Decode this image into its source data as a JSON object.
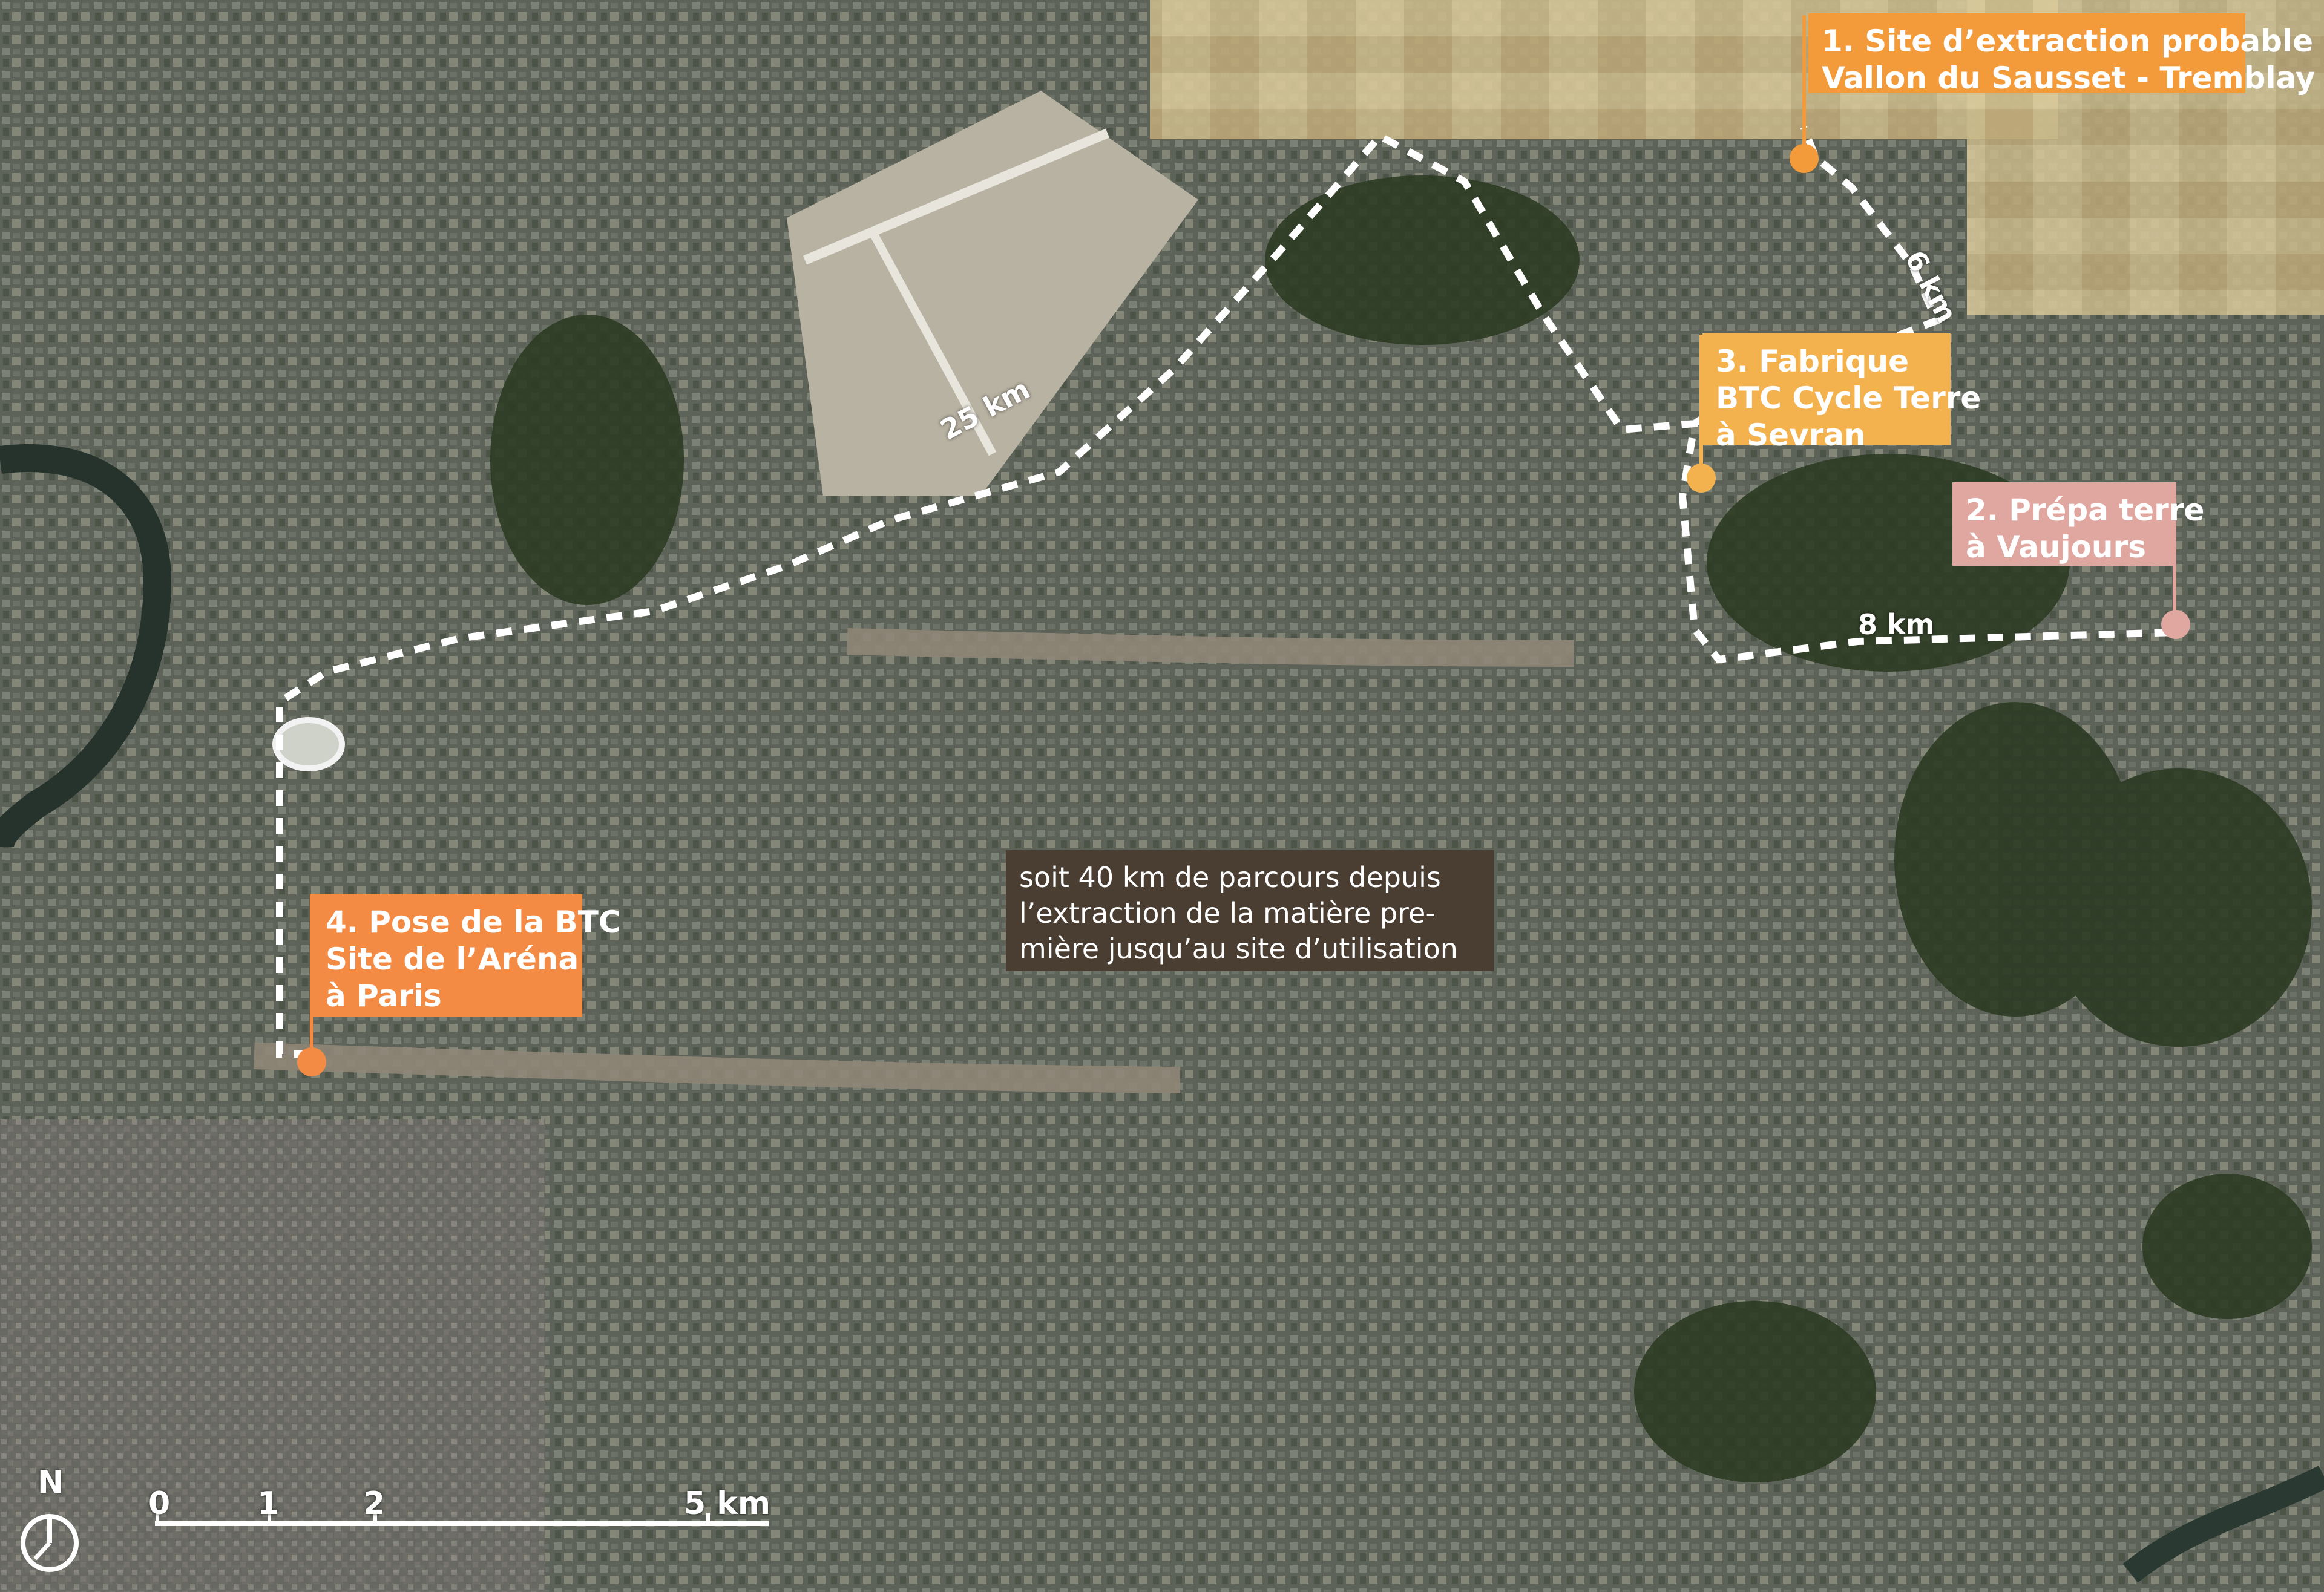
{
  "colors": {
    "orange": "#f39a3a",
    "light_orange": "#f3b24e",
    "pink": "#e0a7a1",
    "dark_box": "#4a3e33",
    "route": "#ffffff"
  },
  "sites": [
    {
      "id": "site-1",
      "lines": [
        "1. Site d’extraction probable",
        "Vallon du Sausset - Tremblay"
      ],
      "color": "#f39a3a"
    },
    {
      "id": "site-2",
      "lines": [
        "2. Prépa terre",
        "à Vaujours"
      ],
      "color": "#e0a7a1"
    },
    {
      "id": "site-3",
      "lines": [
        "3. Fabrique",
        "BTC Cycle Terre",
        "à Sevran"
      ],
      "color": "#f3b24e"
    },
    {
      "id": "site-4",
      "lines": [
        "4. Pose de la BTC",
        "Site de l’Aréna",
        "à Paris"
      ],
      "color": "#f38b45"
    }
  ],
  "summary": {
    "lines": [
      "soit 40 km de parcours depuis",
      "l’extraction de la matière pre-",
      "mière jusqu’au site d’utilisation"
    ]
  },
  "distances": {
    "d6": "6 km",
    "d8": "8 km",
    "d25": "25 km"
  },
  "scale": {
    "labels": [
      "0",
      "1",
      "2",
      "5 km"
    ],
    "north": "N"
  },
  "icons": {
    "north": "north-arrow-icon"
  }
}
